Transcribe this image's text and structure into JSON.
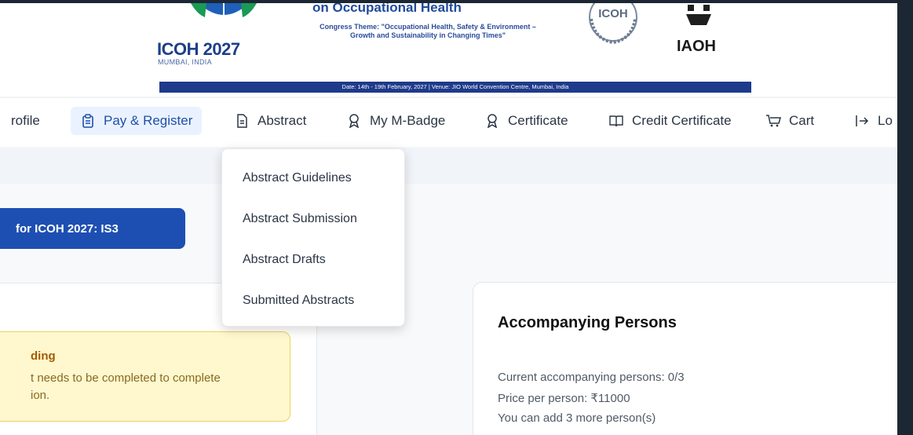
{
  "banner": {
    "congress_title": "on Occupational Health",
    "theme_line1": "Congress Theme: \"Occupational Health, Safety & Environment –",
    "theme_line2": "Growth and Sustainability in Changing Times\"",
    "icoh_logo_text": "ICOH 2027",
    "icoh_logo_sub": "MUMBAI, INDIA",
    "seal_text": "ICOH",
    "iaoh_text": "IAOH",
    "date_venue": "Date: 14th - 19th February, 2027 | Venue: JIO World Convention Centre, Mumbai, India"
  },
  "nav": {
    "items": [
      {
        "label": "rofile",
        "icon": "user-icon"
      },
      {
        "label": "Pay & Register",
        "icon": "clipboard-icon"
      },
      {
        "label": "Abstract",
        "icon": "document-icon"
      },
      {
        "label": "My M-Badge",
        "icon": "badge-icon"
      },
      {
        "label": "Certificate",
        "icon": "award-icon"
      },
      {
        "label": "Credit Certificate",
        "icon": "book-icon"
      },
      {
        "label": "Cart",
        "icon": "cart-icon"
      },
      {
        "label": "Lo",
        "icon": "logout-icon"
      }
    ]
  },
  "dropdown": {
    "items": [
      "Abstract Guidelines",
      "Abstract Submission",
      "Abstract Drafts",
      "Submitted Abstracts"
    ]
  },
  "registration_button": "for ICOH 2027: IS3",
  "alert": {
    "title": "ding",
    "line1": "t needs to be completed to complete",
    "line2": "ion."
  },
  "accompanying": {
    "title": "Accompanying Persons",
    "current": "Current accompanying persons: 0/3",
    "price": "Price per person: ₹11000",
    "remaining": "You can add 3 more person(s)"
  },
  "colors": {
    "brand": "#1d4fb3",
    "active_nav_bg": "#eaf2ff",
    "alert_bg": "#fff8cf",
    "alert_border": "#f1cf5b"
  }
}
